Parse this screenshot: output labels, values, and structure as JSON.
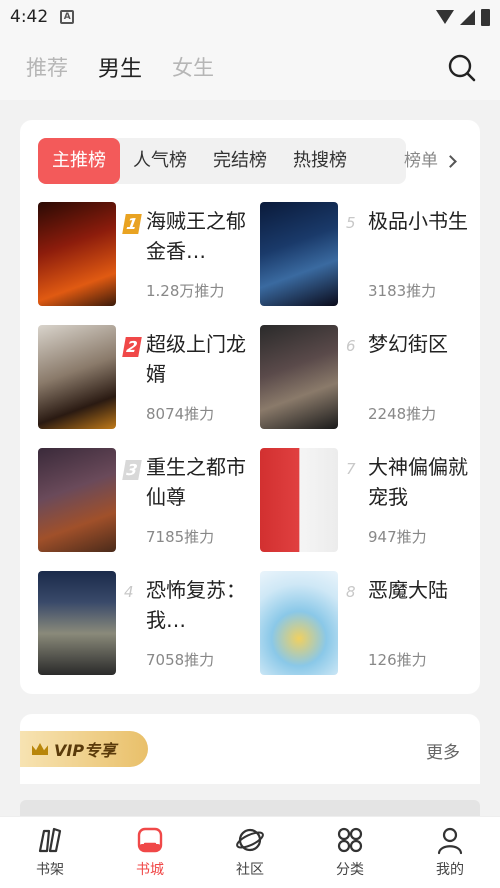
{
  "status": {
    "time": "4:42"
  },
  "top_nav": {
    "tabs": [
      "推荐",
      "男生",
      "女生"
    ],
    "active": 1
  },
  "rank": {
    "tabs": [
      "主推榜",
      "人气榜",
      "完结榜",
      "热搜榜"
    ],
    "more_label": "榜单",
    "books": [
      {
        "rank": "1",
        "title": "海贼王之郁金香…",
        "push": "1.28万推力"
      },
      {
        "rank": "2",
        "title": "超级上门龙婿",
        "push": "8074推力"
      },
      {
        "rank": "3",
        "title": "重生之都市仙尊",
        "push": "7185推力"
      },
      {
        "rank": "4",
        "title": "恐怖复苏：我…",
        "push": "7058推力"
      },
      {
        "rank": "5",
        "title": "极品小书生",
        "push": "3183推力"
      },
      {
        "rank": "6",
        "title": "梦幻街区",
        "push": "2248推力"
      },
      {
        "rank": "7",
        "title": "大神偏偏就宠我",
        "push": "947推力"
      },
      {
        "rank": "8",
        "title": "恶魔大陆",
        "push": "126推力"
      }
    ]
  },
  "vip": {
    "badge": "VIP专享",
    "more": "更多"
  },
  "bottom_nav": {
    "items": [
      "书架",
      "书城",
      "社区",
      "分类",
      "我的"
    ],
    "active": 1
  },
  "colors": {
    "accent": "#f35a5a",
    "rank1": "#e9a322",
    "rank2": "#f04848",
    "rank3": "#d8d8d8"
  }
}
